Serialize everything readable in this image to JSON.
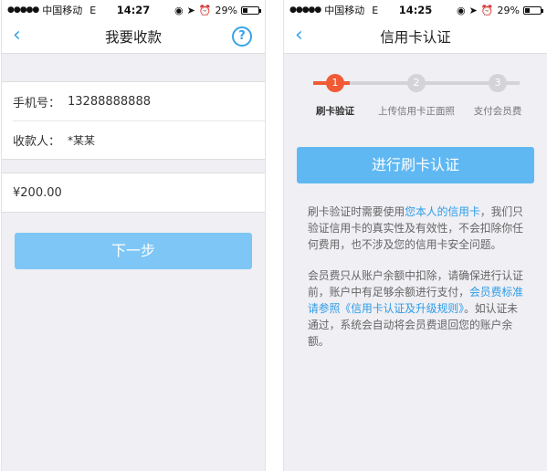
{
  "status_bar": {
    "carrier": "中国移动",
    "network": "E",
    "battery_text": "29%",
    "battery_level": 0.29
  },
  "screen1": {
    "time": "14:27",
    "title": "我要收款",
    "back_icon": "chevron-left-icon",
    "help_icon": "question-mark-icon",
    "phone_label": "手机号：",
    "phone_value": "13288888888",
    "payee_label": "收款人：",
    "payee_value": "*某某",
    "amount_value": "¥200.00",
    "next_button": "下一步"
  },
  "screen2": {
    "time": "14:25",
    "title": "信用卡认证",
    "back_icon": "chevron-left-icon",
    "steps": [
      {
        "number": "1",
        "label": "刷卡验证",
        "active": true
      },
      {
        "number": "2",
        "label": "上传信用卡正面照",
        "active": false
      },
      {
        "number": "3",
        "label": "支付会员费",
        "active": false
      }
    ],
    "action_button": "进行刷卡认证",
    "p1_a": "刷卡验证时需要使用",
    "p1_link": "您本人的信用卡",
    "p1_b": "，我们只验证信用卡的真实性及有效性，不会扣除你任何费用，也不涉及您的信用卡安全问题。",
    "p2_a": "会员费只从账户余额中扣除，请确保进行认证前，账户中有足够余额进行支付，",
    "p2_link": "会员费标准请参照《信用卡认证及升级规则》",
    "p2_b": "。如认证未通过，系统会自动将会员费退回您的账户余额。"
  },
  "colors": {
    "accent": "#39a3e8",
    "button": "#60b8f2",
    "step_active": "#f05a34",
    "step_inactive": "#d4d4d8",
    "background": "#efeff4"
  }
}
